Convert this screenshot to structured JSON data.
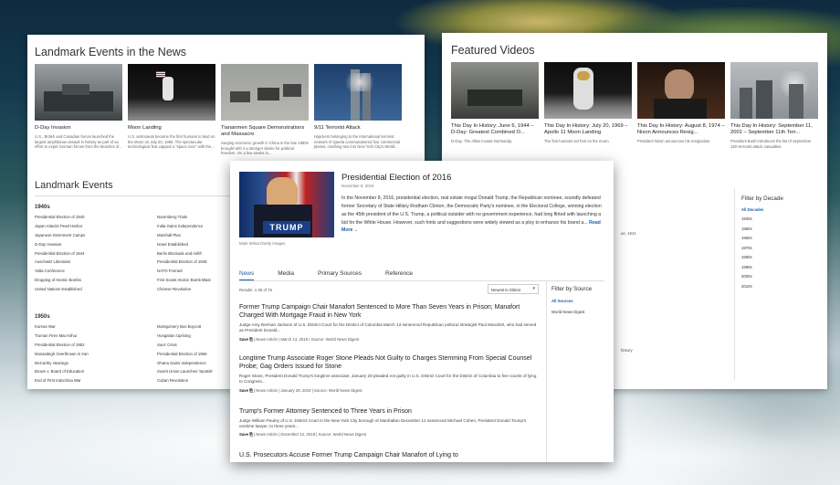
{
  "landmark_news": {
    "title": "Landmark Events in the News",
    "cards": [
      {
        "title": "D-Day Invasion",
        "desc": "U.S., British and Canadian forces launched the largest amphibious assault in history as part of an effort to expel German forces from the beaches of..."
      },
      {
        "title": "Moon Landing",
        "desc": "U.S. astronauts became the first humans to land on the Moon on July 20, 1969. The spectacular technological feat capped a \"space race\" with the..."
      },
      {
        "title": "Tiananmen Square Demonstrations and Massacre",
        "desc": "Surging economic growth in China in the late 1980s brought with it a stronger desire for political freedom. On a few weeks in..."
      },
      {
        "title": "9/11 Terrorist Attack",
        "desc": "Hijackers belonging to the international terrorist network Al Qaeda commandeered four commercial planes, crashing two into New York City's World..."
      }
    ]
  },
  "landmark_events": {
    "title": "Landmark Events",
    "decades": [
      {
        "label": "1940s",
        "col1": [
          "Presidential Election of 1940",
          "Japan Attacks Pearl Harbor",
          "Japanese Internment Camps",
          "D-Day Invasion",
          "Presidential Election of 1944",
          "Auschwitz Liberation",
          "Yalta Conference",
          "Dropping of Atomic Bombs",
          "United Nations Established"
        ],
        "col2": [
          "Nuremberg Trials",
          "India Gains Independence",
          "Marshall Plan",
          "Israel Established",
          "Berlin Blockade and Airlift",
          "Presidential Election of 1948",
          "NATO Formed",
          "First Soviet Atomic Bomb Blast",
          "Chinese Revolution"
        ]
      },
      {
        "label": "1950s",
        "col1": [
          "Korean War",
          "Truman Fires MacArthur",
          "Presidential Election of 1952",
          "Mossadegh Overthrown in Iran",
          "McCarthy Hearings",
          "Brown v. Board of Education",
          "End of First Indochina War"
        ],
        "col2": [
          "Montgomery Bus Boycott",
          "Hungarian Uprising",
          "Suez Crisis",
          "Presidential Election of 1956",
          "Ghana Gains Independence",
          "Soviet Union Launches 'Sputnik'",
          "Cuban Revolution"
        ]
      }
    ]
  },
  "featured_videos": {
    "title": "Featured Videos",
    "cards": [
      {
        "title": "This Day In History: June 6, 1944 – D-Day: Greatest Combined O...",
        "desc": "D-Day: The Allies invade Normandy."
      },
      {
        "title": "This Day In History: July 20, 1969 – Apollo 11 Moon Landing",
        "desc": "The first humans set foot on the moon."
      },
      {
        "title": "This Day In History: August 8, 1974 – Nixon Announces Resig...",
        "desc": "President Nixon announces his resignation."
      },
      {
        "title": "This Day In History: September 11, 2001 – September 11th Terr...",
        "desc": "President Bush introduces the list of September 11th terrorist attack casualties."
      }
    ],
    "filter_title": "Filter by Decade",
    "filter_items": [
      "All Decades",
      "1940s",
      "1950s",
      "1960s",
      "1970s",
      "1980s",
      "1990s",
      "2000s",
      "2010s"
    ],
    "partial_texts": [
      "ue, 1941",
      "history"
    ]
  },
  "election": {
    "title": "Presidential Election of 2016",
    "date": "November 8, 2016",
    "image_credit": "Mark Wilson/Getty Images",
    "podium_text": "TRUMP",
    "summary": "In the November 8, 2016, presidential election, real estate mogul Donald Trump, the Republican nominee, soundly defeated former Secretary of State Hillary Rodham Clinton, the Democratic Party's nominee, in the Electoral College, winning election as the 45th president of the U.S. Trump, a political outsider with no government experience, had long flirted with launching a bid for the White House. However, such hints and suggestions were widely viewed as a ploy to enhance his brand a...",
    "read_more": "Read More",
    "tabs": [
      "News",
      "Media",
      "Primary Sources",
      "Reference"
    ],
    "results_count": "Results: 1-25 of 76",
    "sort_label": "Newest to Oldest",
    "filter_title": "Filter by Source",
    "filter_items": [
      "All Sources",
      "World News Digest"
    ],
    "articles": [
      {
        "title": "Former Trump Campaign Chair Manafort Sentenced to More Than Seven Years in Prison; Manafort Charged With Mortgage Fraud in New York",
        "body": "Judge Amy Berman Jackson of U.S. District Court for the District of Columbia March 13 sentenced Republican political strategist Paul Manafort, who had served as President Donald...",
        "save": "Save",
        "meta": "| News Article | March 13, 2019 | Source: World News Digest"
      },
      {
        "title": "Longtime Trump Associate Roger Stone Pleads Not Guilty to Charges Stemming From Special Counsel Probe; Gag Orders Issued for Stone",
        "body": "Roger Stone, President Donald Trump's longtime associate, January 29 pleaded not guilty in U.S. District Court for the District of Columbia to five counts of lying to Congress...",
        "save": "Save",
        "meta": "| News Article | January 29, 2019 | Source: World News Digest"
      },
      {
        "title": "Trump's Former Attorney Sentenced to Three Years in Prison",
        "body": "Judge William Pauley of U.S. District Court in the New York City borough of Manhattan December 12 sentenced Michael Cohen, President Donald Trump's onetime lawyer, to three years...",
        "save": "Save",
        "meta": "| News Article | December 12, 2018 | Source: World News Digest"
      },
      {
        "title": "U.S. Prosecutors Accuse Former Trump Campaign Chair Manafort of Lying to",
        "body": "",
        "save": "",
        "meta": ""
      }
    ]
  }
}
